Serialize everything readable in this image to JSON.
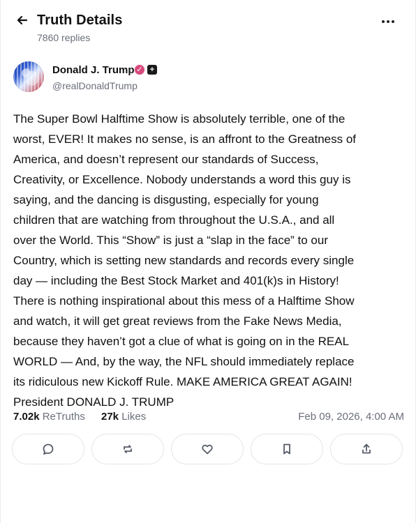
{
  "header": {
    "title": "Truth Details",
    "subtitle": "7860 replies",
    "back_icon": "back-arrow-icon",
    "more_icon": "more-horizontal-icon"
  },
  "author": {
    "name": "Donald J. Trump",
    "handle": "@realDonaldTrump",
    "verified_icon": "verified-check-icon",
    "plus_icon": "plus-badge-icon",
    "avatar_label": "profile-avatar"
  },
  "post": {
    "text": "The Super Bowl Halftime Show is absolutely terrible, one of the\nworst, EVER! It makes no sense, is an affront to the Greatness of\nAmerica, and doesn’t represent our standards of Success,\nCreativity, or Excellence. Nobody understands a word this guy is\nsaying, and the dancing is disgusting, especially for young\nchildren that are watching from throughout the U.S.A., and all\nover the World. This “Show” is just a “slap in the face” to our\nCountry, which is setting new standards and records every single\nday — including the Best Stock Market and 401(k)s in History!\nThere is nothing inspirational about this mess of a Halftime Show\nand watch, it will get great reviews from the Fake News Media,\nbecause they haven’t got a clue of what is going on in the REAL\nWORLD — And, by the way, the NFL should immediately replace\nits ridiculous new Kickoff Rule. MAKE AMERICA GREAT AGAIN!\nPresident DONALD J. TRUMP"
  },
  "stats": {
    "retruths_count": "7.02k",
    "retruths_label": "ReTruths",
    "likes_count": "27k",
    "likes_label": "Likes",
    "date": "Feb 09, 2026, 4:00 AM"
  },
  "actions": [
    {
      "icon": "reply-icon"
    },
    {
      "icon": "retruth-icon"
    },
    {
      "icon": "like-icon"
    },
    {
      "icon": "bookmark-icon"
    },
    {
      "icon": "share-icon"
    }
  ],
  "colors": {
    "text": "#111111",
    "muted": "#6b6f7b",
    "border": "#e4e5ea",
    "verified": "#d84a7d"
  }
}
